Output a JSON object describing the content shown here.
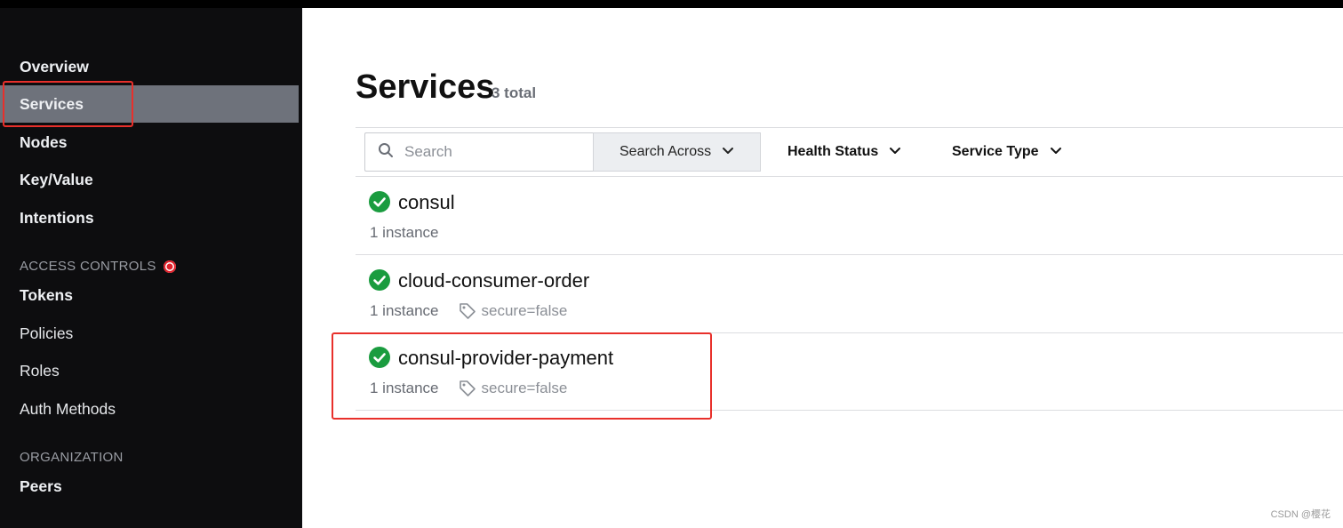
{
  "sidebar": {
    "items": [
      {
        "label": "Overview"
      },
      {
        "label": "Services"
      },
      {
        "label": "Nodes"
      },
      {
        "label": "Key/Value"
      },
      {
        "label": "Intentions"
      }
    ],
    "access_controls": {
      "heading": "ACCESS CONTROLS",
      "items": [
        {
          "label": "Tokens"
        },
        {
          "label": "Policies"
        },
        {
          "label": "Roles"
        },
        {
          "label": "Auth Methods"
        }
      ]
    },
    "organization": {
      "heading": "ORGANIZATION",
      "items": [
        {
          "label": "Peers"
        }
      ]
    }
  },
  "header": {
    "title": "Services",
    "count": "3 total"
  },
  "filters": {
    "search_placeholder": "Search",
    "search_across": "Search Across",
    "health_status": "Health Status",
    "service_type": "Service Type"
  },
  "services": [
    {
      "name": "consul",
      "instances": "1 instance",
      "tag": ""
    },
    {
      "name": "cloud-consumer-order",
      "instances": "1 instance",
      "tag": "secure=false"
    },
    {
      "name": "consul-provider-payment",
      "instances": "1 instance",
      "tag": "secure=false"
    }
  ],
  "watermark": "CSDN @樱花",
  "colors": {
    "sidebar_bg": "#0d0d0f",
    "active_item": "#6e727b",
    "passing_green": "#1a9c3f",
    "highlight_red": "#e8302b"
  },
  "icons": [
    "search-icon",
    "chevron-down-icon",
    "check-circle-icon",
    "tag-icon",
    "alert-dot-icon"
  ]
}
